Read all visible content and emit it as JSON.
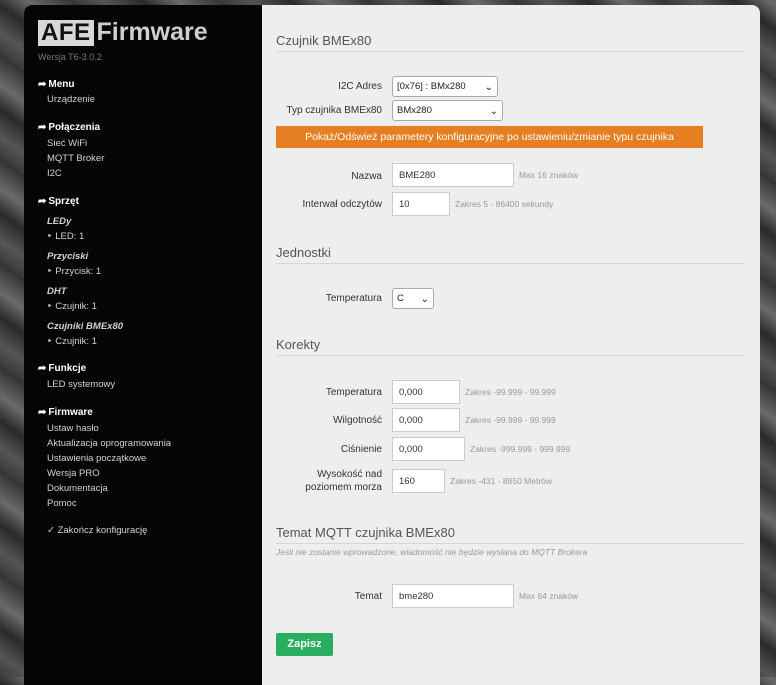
{
  "logo": {
    "afe": "AFE",
    "firmware": "Firmware"
  },
  "version": "Wersja T6-3.0.2",
  "menu": {
    "sections": [
      {
        "label": "Menu"
      },
      {
        "label": "Połączenia"
      },
      {
        "label": "Sprzęt"
      },
      {
        "label": "Funkcje"
      },
      {
        "label": "Firmware"
      }
    ],
    "arrow": "➦",
    "items": {
      "urzadzenie": "Urządzenie",
      "siec_wifi": "Sieć WiFi",
      "mqtt_broker": "MQTT Broker",
      "i2c": "I2C",
      "leds_head": "LEDy",
      "led1": "‣ LED: 1",
      "przyciski_head": "Przyciski",
      "przycisk1": "‣ Przycisk: 1",
      "dht_head": "DHT",
      "dht_czujnik1": "‣ Czujnik: 1",
      "bme_head": "Czujniki BMEx80",
      "bme_czujnik1": "‣ Czujnik: 1",
      "led_systemowy": "LED systemowy",
      "ustaw_haslo": "Ustaw hasło",
      "aktualizacja": "Aktualizacja oprogramowania",
      "ustawienia_poczatkowe": "Ustawienia początkowe",
      "wersja_pro": "Wersja PRO",
      "dokumentacja": "Dokumentacja",
      "pomoc": "Pomoc",
      "zakoncz": "✓ Zakończ konfigurację"
    }
  },
  "form": {
    "title": "Czujnik BMEx80",
    "i2c_label": "I2C Adres",
    "i2c_value": "[0x76] : BMx280",
    "type_label": "Typ czujnika BMEx80",
    "type_value": "BMx280",
    "refresh_button": "Pokaż/Odśwież parametery konfiguracyjne po ustawieniu/zmianie typu czujnika",
    "name_label": "Nazwa",
    "name_value": "BME280",
    "name_hint": "Max 16 znaków",
    "interval_label": "Interwał odczytów",
    "interval_value": "10",
    "interval_hint": "Zakres 5 - 86400 sekundy",
    "units_title": "Jednostki",
    "temp_unit_label": "Temperatura",
    "temp_unit_value": "C",
    "corrections_title": "Korekty",
    "corr_temp_label": "Temperatura",
    "corr_temp_value": "0,000",
    "corr_temp_hint": "Zakres -99.999 - 99.999",
    "corr_hum_label": "Wilgotność",
    "corr_hum_value": "0,000",
    "corr_hum_hint": "Zakres -99.999 - 99.999",
    "corr_press_label": "Ciśnienie",
    "corr_press_value": "0,000",
    "corr_press_hint": "Zakres -999.999 - 999.999",
    "altitude_label_1": "Wysokość nad",
    "altitude_label_2": "poziomem morza",
    "altitude_value": "160",
    "altitude_hint": "Zakres -431 - 8850 Metrów",
    "mqtt_title": "Temat MQTT czujnika BMEx80",
    "mqtt_note": "Jeśli nie zostanie wprowadzone, wiadomość nie będzie wysłana do MQTT Brokera",
    "topic_label": "Temat",
    "topic_value": "bme280",
    "topic_hint": "Max 64 znaków",
    "save_button": "Zapisz"
  }
}
